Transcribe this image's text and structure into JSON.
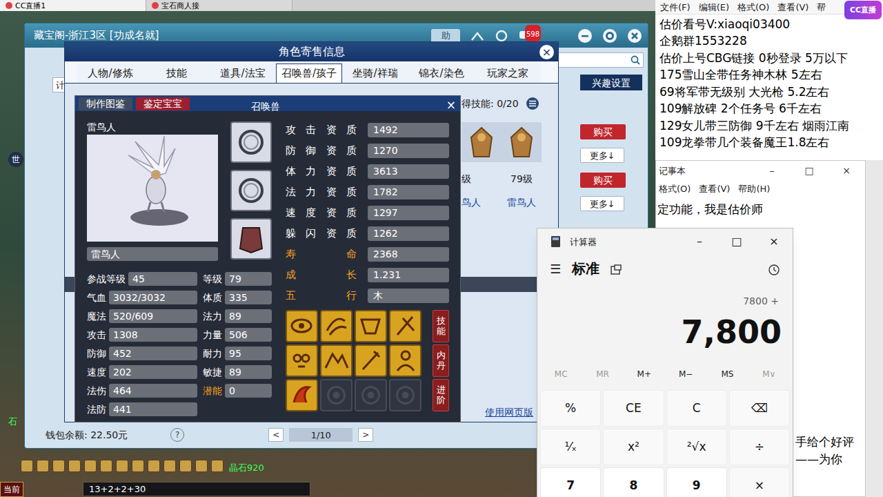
{
  "browser_tabs": [
    {
      "label": "CC直播1",
      "selected": true
    },
    {
      "label": "宝石商人接",
      "selected": false
    }
  ],
  "logo": "CC直播",
  "hud": {
    "world": "世",
    "stone": "石",
    "crystal": "晶石920",
    "formula": "13+2+2+30",
    "current": "当前"
  },
  "cbg": {
    "title": "藏宝阁-浙江3区 [功成名就]",
    "help": "助",
    "badge": "598",
    "side_label": "计",
    "interest": "兴趣设置",
    "actions": [
      {
        "buy": "购买",
        "more": "更多↓"
      },
      {
        "buy": "购买",
        "more": "更多↓"
      }
    ],
    "wallet": "钱包余额: 22.50元",
    "help_mark": "?",
    "prev": "<",
    "page": "1/10",
    "next": ">"
  },
  "panel": {
    "title": "角色寄售信息",
    "close": "×",
    "tabs": [
      {
        "label": "人物/修炼",
        "selected": false
      },
      {
        "label": "技能",
        "selected": false
      },
      {
        "label": "道具/法宝",
        "selected": false
      },
      {
        "label": "召唤兽/孩子",
        "selected": true
      },
      {
        "label": "坐骑/祥瑞",
        "selected": false
      },
      {
        "label": "锦衣/染色",
        "selected": false
      },
      {
        "label": "玩家之家",
        "selected": false
      }
    ],
    "skill_count": "得技能: 0/20",
    "pets": [
      {
        "level": "级",
        "name": "鸟人"
      },
      {
        "level": "79级",
        "name": "雷鸟人"
      }
    ],
    "web_link": "使用网页版"
  },
  "pet": {
    "buttons": [
      "制作图鉴",
      "鉴定宝宝"
    ],
    "title": "召唤兽",
    "close": "×",
    "portrait_name": "雷鸟人",
    "name": "雷鸟人",
    "aptitudes": [
      {
        "label": "攻击资质",
        "value": "1492",
        "highlight": false
      },
      {
        "label": "防御资质",
        "value": "1270",
        "highlight": false
      },
      {
        "label": "体力资质",
        "value": "3613",
        "highlight": false
      },
      {
        "label": "法力资质",
        "value": "1782",
        "highlight": false
      },
      {
        "label": "速度资质",
        "value": "1297",
        "highlight": false
      },
      {
        "label": "躲闪资质",
        "value": "1262",
        "highlight": false
      },
      {
        "label": "寿命",
        "value": "2368",
        "highlight": true
      },
      {
        "label": "成长",
        "value": "1.231",
        "highlight": true
      },
      {
        "label": "五行",
        "value": "木",
        "highlight": true
      }
    ],
    "stats": [
      [
        {
          "label": "参战等级",
          "value": "45",
          "highlight": false
        },
        {
          "label": "等级",
          "value": "79",
          "highlight": false
        }
      ],
      [
        {
          "label": "气血",
          "value": "3032/3032",
          "highlight": false
        },
        {
          "label": "体质",
          "value": "335",
          "highlight": false
        }
      ],
      [
        {
          "label": "魔法",
          "value": "520/609",
          "highlight": false
        },
        {
          "label": "法力",
          "value": "89",
          "highlight": false
        }
      ],
      [
        {
          "label": "攻击",
          "value": "1308",
          "highlight": false
        },
        {
          "label": "力量",
          "value": "506",
          "highlight": false
        }
      ],
      [
        {
          "label": "防御",
          "value": "452",
          "highlight": false
        },
        {
          "label": "耐力",
          "value": "95",
          "highlight": false
        }
      ],
      [
        {
          "label": "速度",
          "value": "202",
          "highlight": false
        },
        {
          "label": "敏捷",
          "value": "89",
          "highlight": false
        }
      ],
      [
        {
          "label": "法伤",
          "value": "464",
          "highlight": false
        },
        {
          "label": "潜能",
          "value": "0",
          "highlight": true
        }
      ],
      [
        {
          "label": "法防",
          "value": "441",
          "highlight": false
        }
      ]
    ],
    "skills": [
      {
        "filled": true
      },
      {
        "filled": true
      },
      {
        "filled": true
      },
      {
        "filled": true
      },
      {
        "filled": true
      },
      {
        "filled": true
      },
      {
        "filled": true
      },
      {
        "filled": true
      },
      {
        "filled": true
      },
      {
        "filled": false
      },
      {
        "filled": false
      },
      {
        "filled": false
      }
    ],
    "side_buttons": [
      "技能",
      "内丹",
      "进阶"
    ]
  },
  "notepad1": {
    "menu": [
      "文件(F)",
      "编辑(E)",
      "格式(O)",
      "查看(V)",
      "帮"
    ],
    "lines": [
      "估价看号V:xiaoqi03400",
      "企鹅群1553228",
      "估价上号CBG链接 0秒登录 5万以下",
      "175雪山全带任务神木林 5左右",
      "69将军带无级别 大光枪 5.2左右",
      "109解放碑 2个任务号 6千左右",
      "129女儿带三防御 9千左右 烟雨江南",
      "109龙拳带几个装备魔王1.8左右"
    ]
  },
  "notepad2": {
    "title": "记事本",
    "controls": [
      "–",
      "□",
      "×"
    ],
    "menu": [
      "格式(O)",
      "查看(V)",
      "帮助(H)"
    ],
    "lines": [
      "定功能，我是估价师"
    ],
    "lower_lines": [
      "手给个好评",
      "——为你"
    ]
  },
  "calculator": {
    "title": "计算器",
    "controls": [
      "–",
      "□",
      "×"
    ],
    "menu_icon": "☰",
    "mode": "标准",
    "expression": "7800 +",
    "display": "7,800",
    "memory": [
      {
        "label": "MC",
        "disabled": true
      },
      {
        "label": "MR",
        "disabled": true
      },
      {
        "label": "M+",
        "disabled": false
      },
      {
        "label": "M−",
        "disabled": false
      },
      {
        "label": "MS",
        "disabled": false
      },
      {
        "label": "M∨",
        "disabled": true
      }
    ],
    "keys": [
      [
        {
          "label": "%",
          "kind": "function"
        },
        {
          "label": "CE",
          "kind": "function"
        },
        {
          "label": "C",
          "kind": "function"
        },
        {
          "label": "⌫",
          "kind": "function"
        }
      ],
      [
        {
          "label": "¹⁄ₓ",
          "kind": "function"
        },
        {
          "label": "x²",
          "kind": "function"
        },
        {
          "label": "²√x",
          "kind": "function"
        },
        {
          "label": "÷",
          "kind": "function"
        }
      ],
      [
        {
          "label": "7",
          "kind": "digit"
        },
        {
          "label": "8",
          "kind": "digit"
        },
        {
          "label": "9",
          "kind": "digit"
        },
        {
          "label": "×",
          "kind": "function"
        }
      ]
    ]
  }
}
